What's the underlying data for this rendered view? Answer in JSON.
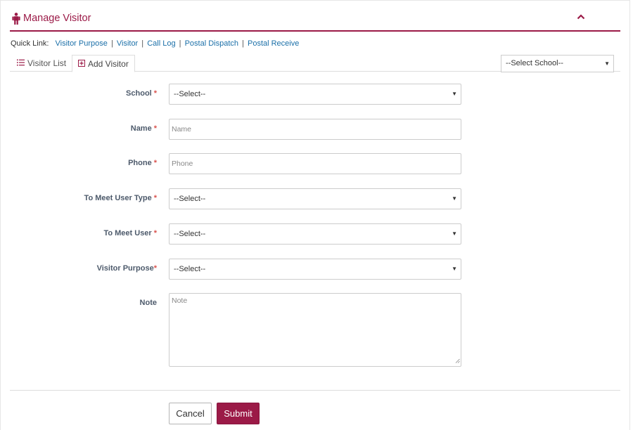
{
  "header": {
    "title": "Manage Visitor",
    "icon": "person-icon",
    "collapse_icon": "chevron-up-icon",
    "accent_color": "#9b1a47"
  },
  "quick_links": {
    "label": "Quick Link:",
    "items": [
      "Visitor Purpose",
      "Visitor",
      "Call Log",
      "Postal Dispatch",
      "Postal Receive"
    ],
    "separator": "|"
  },
  "tabs": [
    {
      "label": "Visitor List",
      "icon": "list-icon",
      "active": false
    },
    {
      "label": "Add Visitor",
      "icon": "plus-square-icon",
      "active": true
    }
  ],
  "school_filter": {
    "value": "--Select School--"
  },
  "form": {
    "required_mark": "*",
    "school": {
      "label": "School",
      "value": "--Select--"
    },
    "name": {
      "label": "Name",
      "placeholder": "Name",
      "value": ""
    },
    "phone": {
      "label": "Phone",
      "placeholder": "Phone",
      "value": ""
    },
    "meet_user_type": {
      "label": "To Meet User Type",
      "value": "--Select--"
    },
    "meet_user": {
      "label": "To Meet User",
      "value": "--Select--"
    },
    "visitor_purpose": {
      "label": "Visitor Purpose",
      "value": "--Select--"
    },
    "note": {
      "label": "Note",
      "placeholder": "Note",
      "value": ""
    }
  },
  "actions": {
    "cancel_label": "Cancel",
    "submit_label": "Submit"
  }
}
